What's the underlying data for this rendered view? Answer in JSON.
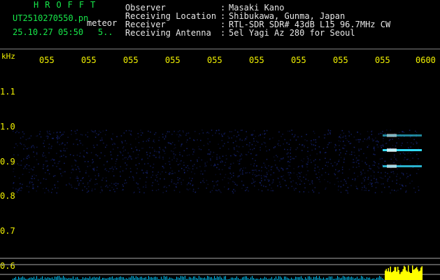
{
  "header": {
    "title": "HROFFT",
    "file_name": "UT2510270550.pn",
    "meteor_label": "meteor",
    "date_time": "25.10.27 05:50",
    "count": "5..",
    "info": [
      {
        "label": "Observer",
        "sep": ":",
        "value": "Masaki Kano"
      },
      {
        "label": "Receiving Location",
        "sep": ":",
        "value": "Shibukawa, Gunma, Japan"
      },
      {
        "label": "Receiver",
        "sep": ":",
        "value": "RTL-SDR SDR# 43dB L15 96.7MHz CW"
      },
      {
        "label": "Receiving Antenna",
        "sep": ":",
        "value": "5el Yagi Az 280 for Seoul"
      }
    ]
  },
  "axis": {
    "y_unit": "kHz",
    "y_ticks": [
      "1.1",
      "1.0",
      "0.9",
      "0.8",
      "0.7",
      "0.6"
    ],
    "x_ticks": [
      "055",
      "055",
      "055",
      "055",
      "055",
      "055",
      "055",
      "055",
      "055",
      "0600"
    ]
  },
  "colors": {
    "header_green": "#17e84a",
    "header_white": "#e8e8e8",
    "tick_yellow": "#f2f200",
    "noise_blue": "#1a2a8a",
    "echo_cyan": "#33ddff",
    "spectrum_cyan": "#00c8ff",
    "spectrum_yellow": "#ffff00"
  }
}
